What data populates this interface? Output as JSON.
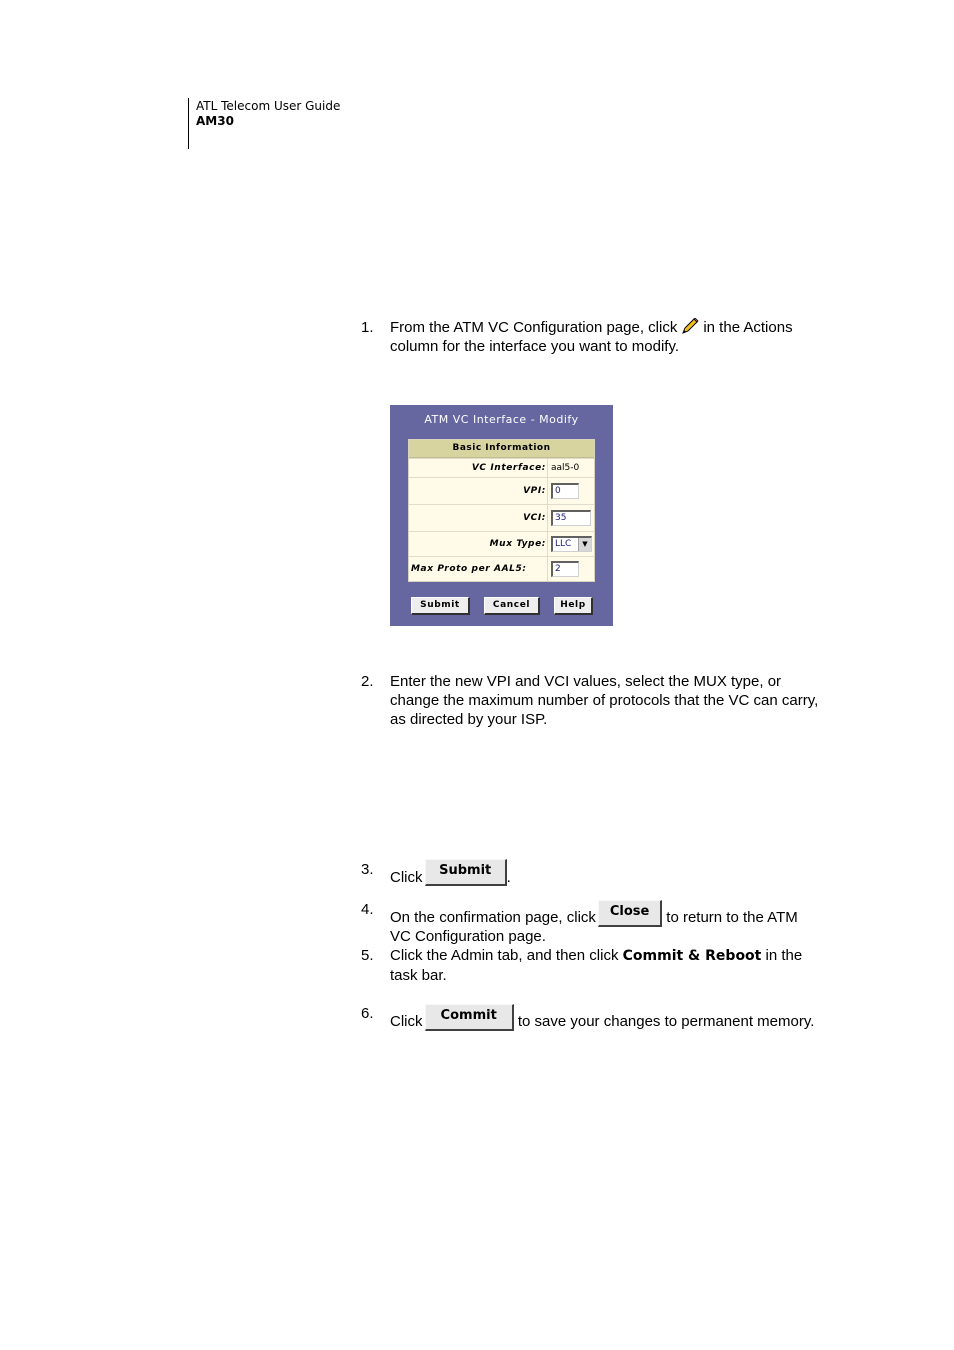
{
  "header": {
    "title": "ATL Telecom User Guide",
    "model": "AM30"
  },
  "steps": [
    {
      "num": "1.",
      "before": "From the ATM VC Configuration page, click",
      "icon": "pencil-edit-icon",
      "after": "in the Actions column for the interface you want to modify."
    },
    {
      "num": "2.",
      "text": "Enter the new VPI and VCI values, select the MUX type, or change the maximum number of protocols that the VC can carry, as directed by your ISP."
    },
    {
      "num": "3.",
      "before": "Click",
      "button": "Submit",
      "after": "."
    },
    {
      "num": "4.",
      "before": "On the confirmation page, click",
      "button": "Close",
      "after": "to return to the ATM VC Configuration page."
    },
    {
      "num": "5.",
      "before": "Click the Admin tab, and then click",
      "bold": "Commit & Reboot",
      "after": "in the task bar."
    },
    {
      "num": "6.",
      "before": "Click",
      "button": "Commit",
      "after": "to save your changes to permanent memory."
    }
  ],
  "dialog": {
    "title": "ATM VC Interface - Modify",
    "section": "Basic Information",
    "rows": [
      {
        "label": "VC Interface:",
        "value": "aal5-0",
        "type": "text"
      },
      {
        "label": "VPI:",
        "value": "0",
        "type": "input"
      },
      {
        "label": "VCI:",
        "value": "35",
        "type": "input"
      },
      {
        "label": "Mux Type:",
        "value": "LLC",
        "type": "select"
      },
      {
        "label": "Max Proto per AAL5:",
        "value": "2",
        "type": "input"
      }
    ],
    "buttons": {
      "submit": "Submit",
      "cancel": "Cancel",
      "help": "Help"
    },
    "colors": {
      "panel": "#6666a0",
      "table_bg": "#fffbe8",
      "header_bg": "#d8d4a0"
    }
  }
}
